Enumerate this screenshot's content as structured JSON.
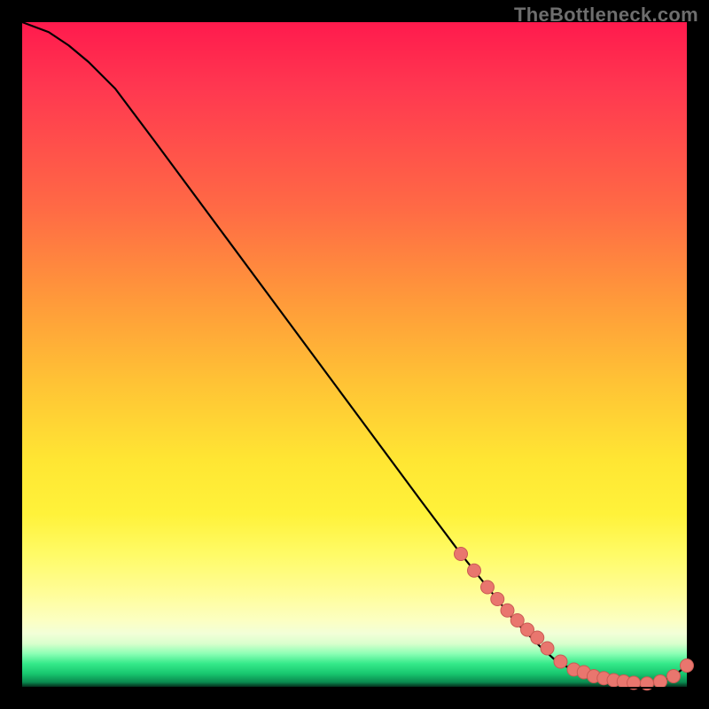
{
  "watermark": "TheBottleneck.com",
  "colors": {
    "background": "#000000",
    "curve_stroke": "#000000",
    "marker_fill": "#e9766e",
    "marker_stroke": "#c95a53"
  },
  "chart_data": {
    "type": "line",
    "title": "",
    "xlabel": "",
    "ylabel": "",
    "xlim": [
      0,
      100
    ],
    "ylim": [
      0,
      100
    ],
    "grid": false,
    "legend": false,
    "x": [
      0,
      4,
      7,
      10,
      14,
      20,
      30,
      40,
      50,
      60,
      66,
      70,
      74,
      78,
      80,
      82,
      84,
      86,
      88,
      90,
      92,
      94,
      96,
      98,
      100
    ],
    "y": [
      100,
      98.5,
      96.5,
      94,
      90,
      82,
      68.5,
      55,
      41.5,
      28,
      20,
      15,
      10,
      6,
      4.2,
      3,
      2.2,
      1.6,
      1.2,
      0.8,
      0.6,
      0.5,
      0.8,
      1.6,
      3.2
    ],
    "markers_x": [
      66,
      68,
      70,
      71.5,
      73,
      74.5,
      76,
      77.5,
      79,
      81,
      83,
      84.5,
      86,
      87.5,
      89,
      90.5,
      92,
      94,
      96,
      98,
      100
    ],
    "markers_y": [
      20,
      17.5,
      15,
      13.2,
      11.5,
      10,
      8.6,
      7.4,
      5.8,
      3.8,
      2.6,
      2.2,
      1.6,
      1.3,
      1.0,
      0.8,
      0.6,
      0.5,
      0.8,
      1.6,
      3.2
    ]
  }
}
